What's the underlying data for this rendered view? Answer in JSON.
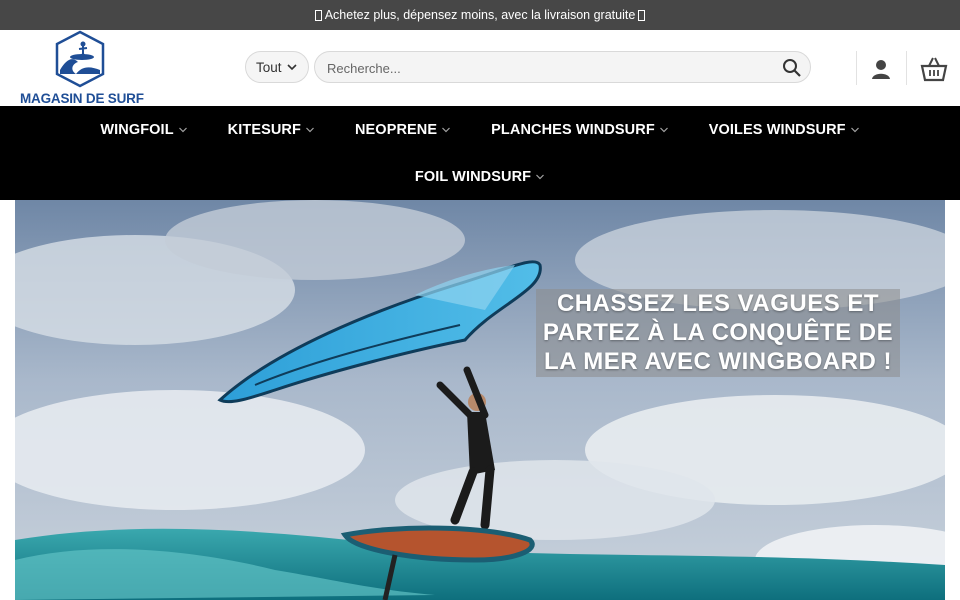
{
  "promo": {
    "text": "Achetez plus, dépensez moins, avec la livraison gratuite"
  },
  "header": {
    "logo_text": "MAGASIN DE SURF",
    "category_select": {
      "selected": "Tout"
    },
    "search": {
      "placeholder": "Recherche..."
    },
    "icons": [
      "search-icon",
      "user-icon",
      "cart-icon",
      "chevron-down-icon"
    ]
  },
  "nav": {
    "items": [
      {
        "label": "WINGFOIL"
      },
      {
        "label": "KITESURF"
      },
      {
        "label": "NEOPRENE"
      },
      {
        "label": "PLANCHES WINDSURF"
      },
      {
        "label": "VOILES WINDSURF"
      },
      {
        "label": "FOIL WINDSURF"
      }
    ]
  },
  "hero": {
    "lines": [
      "CHASSEZ LES VAGUES ET",
      "PARTEZ À LA CONQUÊTE DE",
      "LA MER AVEC WINGBOARD !"
    ]
  },
  "colors": {
    "promo_bg": "#474747",
    "nav_bg": "#000000",
    "brand_blue": "#1f4e96",
    "sky": "#8ea4bf",
    "sea": "#2f9aa3",
    "wing": "#37a7dd"
  }
}
